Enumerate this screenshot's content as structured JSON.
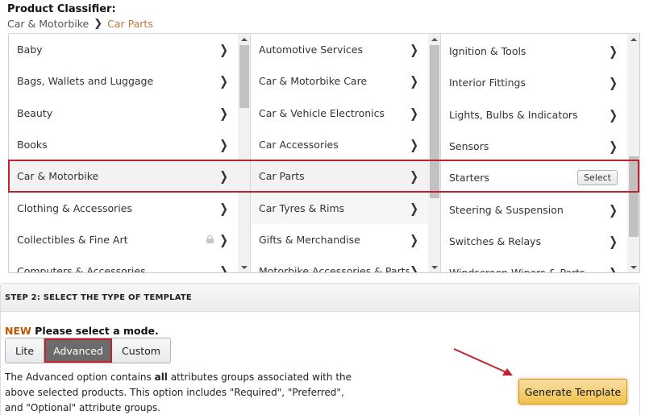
{
  "header": {
    "title": "Product Classifier:",
    "breadcrumb": {
      "parent": "Car & Motorbike",
      "separator": "❯",
      "current": "Car Parts"
    }
  },
  "classifier": {
    "columns": [
      {
        "items": [
          {
            "label": "Baby"
          },
          {
            "label": "Bags, Wallets and Luggage"
          },
          {
            "label": "Beauty"
          },
          {
            "label": "Books"
          },
          {
            "label": "Car & Motorbike",
            "selected": true
          },
          {
            "label": "Clothing & Accessories"
          },
          {
            "label": "Collectibles & Fine Art",
            "locked": true
          },
          {
            "label": "Computers & Accessories"
          }
        ]
      },
      {
        "items": [
          {
            "label": "Automotive Services"
          },
          {
            "label": "Car & Motorbike Care"
          },
          {
            "label": "Car & Vehicle Electronics"
          },
          {
            "label": "Car Accessories"
          },
          {
            "label": "Car Parts",
            "selected": true
          },
          {
            "label": "Car Tyres & Rims"
          },
          {
            "label": "Gifts & Merchandise"
          },
          {
            "label": "Motorbike Accessories & Parts"
          }
        ]
      },
      {
        "items": [
          {
            "label": "Ignition & Tools"
          },
          {
            "label": "Interior Fittings"
          },
          {
            "label": "Lights, Bulbs & Indicators"
          },
          {
            "label": "Sensors"
          },
          {
            "label": "Starters",
            "leaf": true
          },
          {
            "label": "Steering & Suspension"
          },
          {
            "label": "Switches & Relays"
          },
          {
            "label": "Windscreen Wipers & Parts"
          }
        ]
      }
    ],
    "select_label": "Select",
    "chevron": "❯"
  },
  "step2": {
    "header": "STEP 2: SELECT THE TYPE OF TEMPLATE",
    "new_badge": "NEW",
    "prompt": "Please select a mode.",
    "modes": [
      {
        "label": "Lite",
        "active": false
      },
      {
        "label": "Advanced",
        "active": true
      },
      {
        "label": "Custom",
        "active": false
      }
    ],
    "description_pre": "The Advanced option contains ",
    "description_bold": "all",
    "description_post": " attributes groups associated with the above selected products. This option includes \"Required\", \"Preferred\", and \"Optional\" attribute groups.",
    "generate_label": "Generate Template"
  },
  "colors": {
    "highlight": "#c0232b",
    "breadcrumb_current": "#c0763e",
    "new_badge": "#c45500",
    "generate_button": "#f0c14b"
  }
}
